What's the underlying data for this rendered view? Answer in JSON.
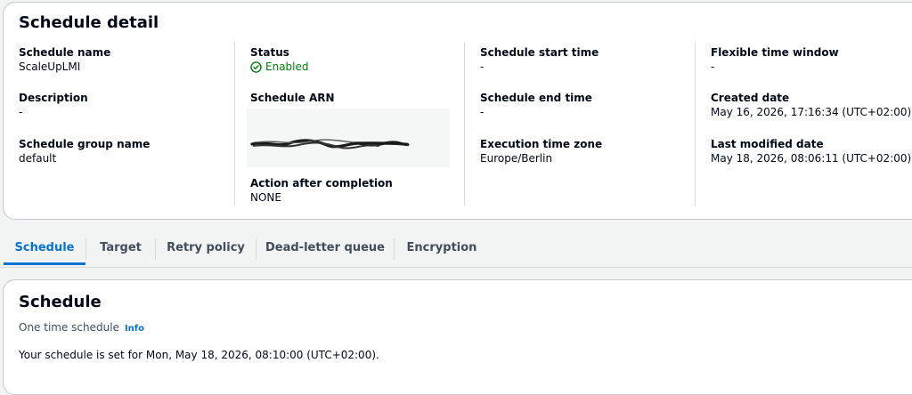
{
  "detail": {
    "title": "Schedule detail",
    "schedule_name": {
      "label": "Schedule name",
      "value": "ScaleUpLMI"
    },
    "description": {
      "label": "Description",
      "value": "-"
    },
    "schedule_group_name": {
      "label": "Schedule group name",
      "value": "default"
    },
    "status": {
      "label": "Status",
      "value": "Enabled"
    },
    "schedule_arn": {
      "label": "Schedule ARN"
    },
    "action_after_completion": {
      "label": "Action after completion",
      "value": "NONE"
    },
    "schedule_start_time": {
      "label": "Schedule start time",
      "value": "-"
    },
    "schedule_end_time": {
      "label": "Schedule end time",
      "value": "-"
    },
    "execution_time_zone": {
      "label": "Execution time zone",
      "value": "Europe/Berlin"
    },
    "flexible_time_window": {
      "label": "Flexible time window",
      "value": "-"
    },
    "created_date": {
      "label": "Created date",
      "value": "May 16, 2026, 17:16:34 (UTC+02:00)"
    },
    "last_modified_date": {
      "label": "Last modified date",
      "value": "May 18, 2026, 08:06:11 (UTC+02:00)"
    }
  },
  "tabs": [
    {
      "label": "Schedule",
      "active": true
    },
    {
      "label": "Target"
    },
    {
      "label": "Retry policy"
    },
    {
      "label": "Dead-letter queue"
    },
    {
      "label": "Encryption"
    }
  ],
  "schedule_section": {
    "title": "Schedule",
    "subtitle": "One time schedule",
    "info_link": "Info",
    "description": "Your schedule is set for Mon, May 18, 2026, 08:10:00 (UTC+02:00)."
  },
  "colors": {
    "accent": "#0972d3",
    "success": "#037f0c",
    "border": "#c6c6cd",
    "background": "#f2f3f3"
  },
  "icons": {
    "status": "check-circle-icon"
  }
}
